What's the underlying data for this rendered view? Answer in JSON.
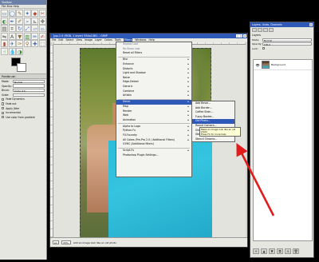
{
  "toolbox": {
    "title": "Toolbox",
    "menu": "File  Xtns  Help",
    "options_title": "Paintbrush",
    "mode_label": "Mode:",
    "mode_value": "Normal",
    "opacity_label": "Opacity:",
    "brush_label": "Brush:",
    "brush_value": "Circle (11)",
    "scale_label": "Scale:",
    "chk1": "Fade Dynamics",
    "chk2": "Fade out",
    "chk3": "Apply Jitter",
    "chk4": "Incremental",
    "chk5": "Use color from gradient"
  },
  "image_window": {
    "title": "[pp-1.0 (RGB, 1 layer) 934x1381 – GIMP",
    "menus": [
      "File",
      "Edit",
      "Select",
      "View",
      "Image",
      "Layer",
      "Colors",
      "Tools",
      "Filters",
      "Windows",
      "Help"
    ],
    "selected_menu": "Filters",
    "status_zoom": "33%",
    "status_unit": "px",
    "status_text": "Add an image look like an old photo"
  },
  "filters_menu": {
    "items": [
      {
        "label": "Repeat Last",
        "arrow": false,
        "dim": true
      },
      {
        "label": "Re-Show Last",
        "arrow": false,
        "dim": true
      },
      {
        "label": "Reset all Filters",
        "arrow": false,
        "dim": false
      },
      {
        "sep": true
      },
      {
        "label": "Blur",
        "arrow": true
      },
      {
        "label": "Enhance",
        "arrow": true
      },
      {
        "label": "Distorts",
        "arrow": true
      },
      {
        "label": "Light and Shadow",
        "arrow": true
      },
      {
        "label": "Noise",
        "arrow": true
      },
      {
        "label": "Edge-Detect",
        "arrow": true
      },
      {
        "label": "Generic",
        "arrow": true
      },
      {
        "label": "Combine",
        "arrow": true
      },
      {
        "label": "Artistic",
        "arrow": true
      },
      {
        "sep": true
      },
      {
        "label": "Decor",
        "arrow": true,
        "hl": true
      },
      {
        "label": "Map",
        "arrow": true
      },
      {
        "label": "Render",
        "arrow": true
      },
      {
        "label": "Web",
        "arrow": true
      },
      {
        "label": "Animation",
        "arrow": true
      },
      {
        "sep": true
      },
      {
        "label": "Alpha to Logo",
        "arrow": true
      },
      {
        "label": "Python-Fu",
        "arrow": true
      },
      {
        "label": "FX-Foundry",
        "arrow": true
      },
      {
        "label": "All Cokes (Pre-Pro 2.0 / Additional Filters)",
        "arrow": true
      },
      {
        "label": "G'MIC (Additional filters)",
        "arrow": false
      },
      {
        "sep": true
      },
      {
        "label": "Script-Fu",
        "arrow": true
      },
      {
        "label": "Photoshop Plugin Settings...",
        "arrow": false
      }
    ]
  },
  "decor_menu": {
    "items": [
      {
        "label": "Add Bevel...",
        "hl": false
      },
      {
        "label": "Add Border...",
        "hl": false
      },
      {
        "label": "Coffee Stain...",
        "hl": false
      },
      {
        "label": "Fuzzy Border...",
        "hl": false
      },
      {
        "label": "Old Photo...",
        "hl": true
      },
      {
        "label": "Round Corners...",
        "hl": false
      },
      {
        "label": "Slide...",
        "hl": false
      },
      {
        "label": "Stencil Carve...",
        "hl": false
      },
      {
        "label": "Stencil Chrome...",
        "hl": false
      }
    ]
  },
  "tooltip": {
    "line1": "Make an image look like an old photo",
    "line2": "Press F1 for more help"
  },
  "layers": {
    "title": "Layers, Undo, Channels",
    "section": "Layers",
    "mode_label": "Mode:",
    "mode_value": "Normal",
    "opacity_label": "Opacity:",
    "opacity_value": "100.0",
    "lock_label": "Lock:",
    "layer_name": "Background"
  }
}
